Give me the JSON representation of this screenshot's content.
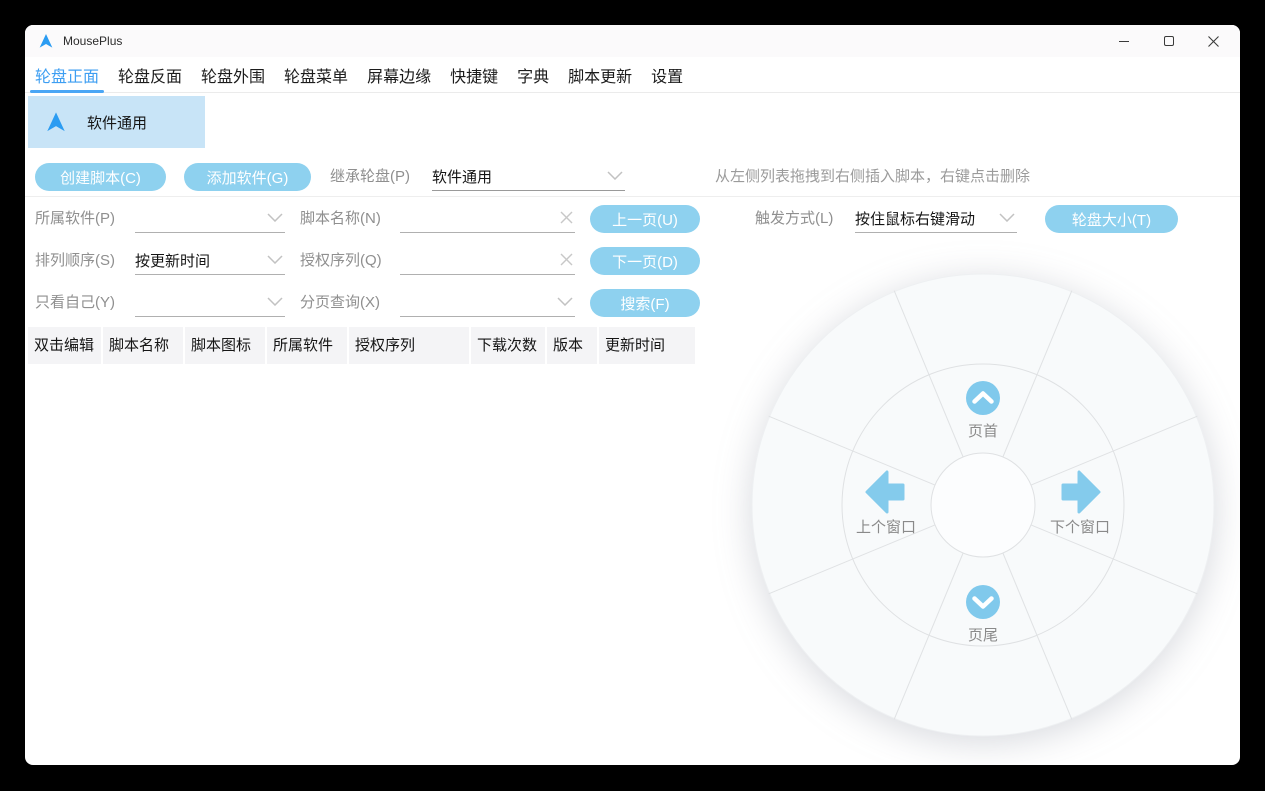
{
  "window": {
    "title": "MousePlus"
  },
  "titlebar": {
    "controls": [
      "minimize",
      "maximize",
      "close"
    ]
  },
  "tabs": [
    {
      "label": "轮盘正面",
      "active": true
    },
    {
      "label": "轮盘反面",
      "active": false
    },
    {
      "label": "轮盘外围",
      "active": false
    },
    {
      "label": "轮盘菜单",
      "active": false
    },
    {
      "label": "屏幕边缘",
      "active": false
    },
    {
      "label": "快捷键",
      "active": false
    },
    {
      "label": "字典",
      "active": false
    },
    {
      "label": "脚本更新",
      "active": false
    },
    {
      "label": "设置",
      "active": false
    }
  ],
  "profile": {
    "name": "软件通用"
  },
  "toolbar": {
    "create_script_button": "创建脚本(C)",
    "add_software_button": "添加软件(G)",
    "inherit_wheel": {
      "label": "继承轮盘(P)",
      "value": "软件通用"
    },
    "hint": "从左侧列表拖拽到右侧插入脚本，右键点击删除"
  },
  "filters": {
    "owner_software": {
      "label": "所属软件(P)",
      "value": ""
    },
    "script_name": {
      "label": "脚本名称(N)",
      "value": ""
    },
    "sort_order": {
      "label": "排列顺序(S)",
      "value": "按更新时间"
    },
    "auth_serial": {
      "label": "授权序列(Q)",
      "value": ""
    },
    "only_mine": {
      "label": "只看自己(Y)",
      "value": ""
    },
    "page_query": {
      "label": "分页查询(X)",
      "value": ""
    },
    "prev_page_button": "上一页(U)",
    "next_page_button": "下一页(D)",
    "search_button": "搜索(F)"
  },
  "trigger": {
    "label": "触发方式(L)",
    "value": "按住鼠标右键滑动",
    "wheel_size_button": "轮盘大小(T)"
  },
  "table": {
    "columns": [
      "双击编辑",
      "脚本名称",
      "脚本图标",
      "所属软件",
      "授权序列",
      "下载次数",
      "版本",
      "更新时间"
    ],
    "rows": []
  },
  "wheel": {
    "sectors": 8,
    "top": {
      "label": "页首",
      "icon": "chevron-up-circle-icon"
    },
    "left": {
      "label": "上个窗口",
      "icon": "arrow-left-icon"
    },
    "right": {
      "label": "下个窗口",
      "icon": "arrow-right-icon"
    },
    "bottom": {
      "label": "页尾",
      "icon": "chevron-down-circle-icon"
    }
  },
  "colors": {
    "accent_blue": "#3d9ef2",
    "button_blue": "#8ed1ef",
    "selected_item_bg": "#c8e4f7",
    "wheel_arrow_blue": "#84cbec",
    "label_gray": "#8f8f8f"
  }
}
